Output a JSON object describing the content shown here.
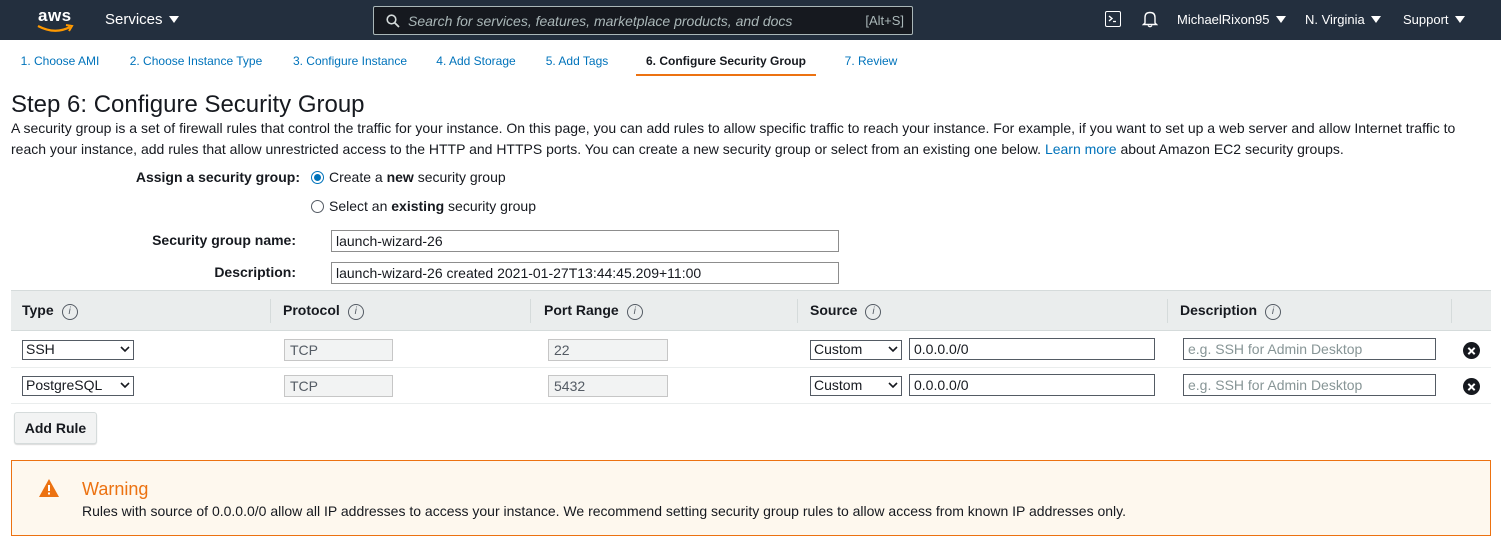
{
  "topnav": {
    "logo_text": "aws",
    "services_label": "Services",
    "search_placeholder": "Search for services, features, marketplace products, and docs",
    "search_shortcut": "[Alt+S]",
    "username": "MichaelRixon95",
    "region": "N. Virginia",
    "support": "Support",
    "icons": [
      "cloudshell-icon",
      "bell-icon"
    ]
  },
  "tabs": [
    {
      "label": "1. Choose AMI"
    },
    {
      "label": "2. Choose Instance Type"
    },
    {
      "label": "3. Configure Instance"
    },
    {
      "label": "4. Add Storage"
    },
    {
      "label": "5. Add Tags"
    },
    {
      "label": "6. Configure Security Group",
      "active": true
    },
    {
      "label": "7. Review"
    }
  ],
  "page": {
    "title": "Step 6: Configure Security Group",
    "intro_text": "A security group is a set of firewall rules that control the traffic for your instance. On this page, you can add rules to allow specific traffic to reach your instance. For example, if you want to set up a web server and allow Internet traffic to reach your instance, add rules that allow unrestricted access to the HTTP and HTTPS ports. You can create a new security group or select from an existing one below.",
    "learn_more": "Learn more",
    "intro_suffix": "about Amazon EC2 security groups."
  },
  "form": {
    "assign_label": "Assign a security group:",
    "radio_new_pre": "Create a ",
    "radio_new_bold": "new",
    "radio_new_post": " security group",
    "radio_existing_pre": "Select an ",
    "radio_existing_bold": "existing",
    "radio_existing_post": " security group",
    "name_label": "Security group name:",
    "name_value": "launch-wizard-26",
    "description_label": "Description:",
    "description_value": "launch-wizard-26 created 2021-01-27T13:44:45.209+11:00"
  },
  "table": {
    "headers": {
      "type": "Type",
      "protocol": "Protocol",
      "port_range": "Port Range",
      "source": "Source",
      "description": "Description"
    },
    "info_glyph": "i",
    "description_placeholder": "e.g. SSH for Admin Desktop",
    "rows": [
      {
        "type": "SSH",
        "protocol": "TCP",
        "port": "22",
        "source_type": "Custom",
        "source_value": "0.0.0.0/0"
      },
      {
        "type": "PostgreSQL",
        "protocol": "TCP",
        "port": "5432",
        "source_type": "Custom",
        "source_value": "0.0.0.0/0"
      }
    ]
  },
  "add_rule_label": "Add Rule",
  "warning": {
    "title": "Warning",
    "text": "Rules with source of 0.0.0.0/0 allow all IP addresses to access your instance. We recommend setting security group rules to allow access from known IP addresses only."
  },
  "colors": {
    "nav_bg": "#232f3e",
    "link": "#0073bb",
    "accent_orange": "#ec7211",
    "warning_bg": "#fef8ee"
  }
}
